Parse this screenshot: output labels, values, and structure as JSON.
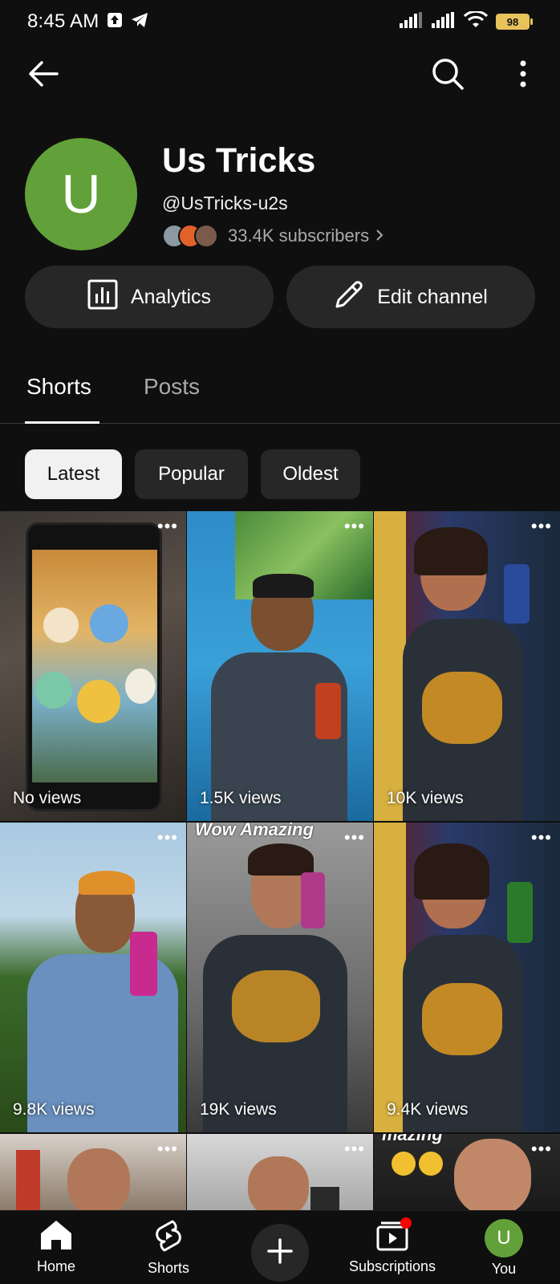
{
  "status_bar": {
    "time": "8:45 AM",
    "battery": "98"
  },
  "top_bar": {
    "back_icon": "arrow-left-icon",
    "search_icon": "search-icon",
    "more_icon": "more-vert-icon"
  },
  "channel": {
    "avatar_letter": "U",
    "avatar_color": "#62a139",
    "name": "Us Tricks",
    "handle": "@UsTricks-u2s",
    "subscribers": "33.4K subscribers",
    "analytics_label": "Analytics",
    "edit_label": "Edit channel"
  },
  "tabs": [
    {
      "label": "Shorts",
      "active": true
    },
    {
      "label": "Posts",
      "active": false
    }
  ],
  "chips": [
    {
      "label": "Latest",
      "selected": true
    },
    {
      "label": "Popular",
      "selected": false
    },
    {
      "label": "Oldest",
      "selected": false
    }
  ],
  "shorts": [
    {
      "views": "No views",
      "overlay": ""
    },
    {
      "views": "1.5K views",
      "overlay": ""
    },
    {
      "views": "10K views",
      "overlay": ""
    },
    {
      "views": "9.8K views",
      "overlay": ""
    },
    {
      "views": "19K views",
      "overlay": "Wow Amazing"
    },
    {
      "views": "9.4K views",
      "overlay": ""
    },
    {
      "views": "",
      "overlay": ""
    },
    {
      "views": "",
      "overlay": ""
    },
    {
      "views": "",
      "overlay": "mazing"
    }
  ],
  "bottom_nav": {
    "home": "Home",
    "shorts": "Shorts",
    "subscriptions": "Subscriptions",
    "you": "You",
    "you_letter": "U"
  },
  "colors": {
    "background": "#0f0f0f",
    "surface": "#272727",
    "accent_green": "#62a139",
    "notification_red": "#ff0000"
  }
}
